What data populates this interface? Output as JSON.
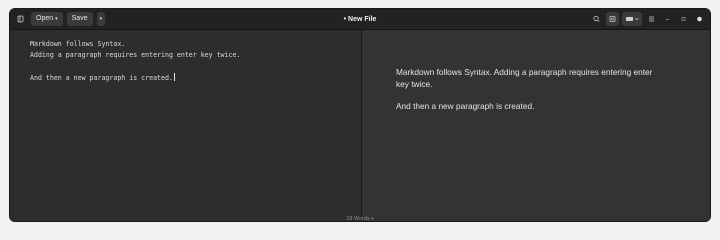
{
  "window": {
    "title": "New File",
    "modified_marker": "•"
  },
  "toolbar": {
    "sidebar_icon": "sidebar-icon",
    "open_label": "Open",
    "save_label": "Save",
    "more_icon": "chevron-down-icon",
    "search_icon": "search-icon",
    "preview_toggle_icon": "preview-icon",
    "layout_menu_icon": "split-layout-icon",
    "main_menu_icon": "hamburger-menu-icon",
    "minimize_icon": "minimize-icon",
    "maximize_icon": "maximize-icon",
    "close_icon": "close-icon"
  },
  "editor": {
    "lines": [
      "Markdown follows Syntax.",
      "Adding a paragraph requires entering enter key twice.",
      "",
      "And then a new paragraph is created."
    ]
  },
  "preview": {
    "paragraphs": [
      "Markdown follows Syntax. Adding a paragraph requires entering enter key twice.",
      "And then a new paragraph is created."
    ]
  },
  "status": {
    "word_count": "18 Words"
  },
  "colors": {
    "window_bg": "#2b2b2b",
    "headerbar_bg": "#222222",
    "editor_bg": "#2d2d2d",
    "preview_bg": "#333333",
    "text": "#e4e4e4"
  }
}
